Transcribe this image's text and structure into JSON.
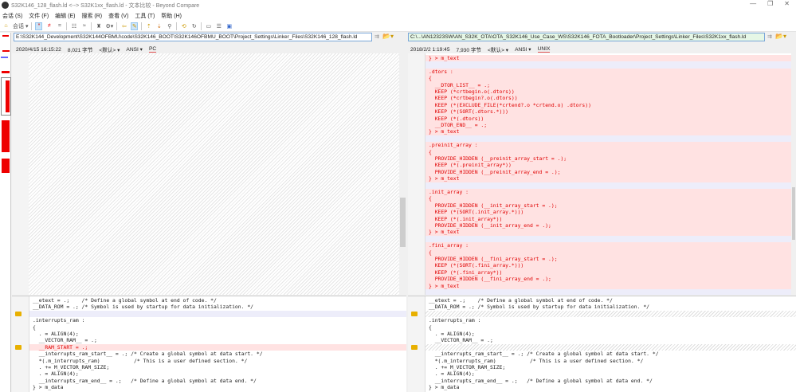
{
  "title": "S32K146_128_flash.ld <--> S32K1xx_flash.ld - 文本比较 - Beyond Compare",
  "menu": [
    "会话 (S)",
    "文件 (F)",
    "编辑 (E)",
    "搜索 (R)",
    "查看 (V)",
    "工具 (T)",
    "帮助 (H)"
  ],
  "toolbar": {
    "session_label": "会话"
  },
  "left": {
    "path": "E:\\S32K144_Development\\S32K144OFBMU\\code\\S32K146_BOOT\\S32K146OFBMU_BOOT\\Project_Settings\\Linker_Files\\S32K146_128_flash.ld",
    "date": "2020/4/15 16:15:22",
    "size": "8,021 字节",
    "format": "<默认>",
    "encoding": "ANSI",
    "eol": "PC"
  },
  "right": {
    "path": "C:\\...\\AN12323SW\\AN_S32K_OTA\\OTA_S32K146_Use_Case_WS\\S32K146_FOTA_Bootloader\\Project_Settings\\Linker_Files\\S32K1xx_flash.ld",
    "date": "2018/2/2 1:19:45",
    "size": "7,930 字节",
    "format": "<默认>",
    "encoding": "ANSI",
    "eol": "UNIX"
  },
  "right_top_lines": [
    {
      "t": "} > m_text",
      "k": "diff"
    },
    {
      "t": "",
      "k": "gap"
    },
    {
      "t": ".dtors :",
      "k": "diff"
    },
    {
      "t": "{",
      "k": "diff"
    },
    {
      "t": "  __DTOR_LIST__ = .;",
      "k": "diff"
    },
    {
      "t": "  KEEP (*crtbegin.o(.dtors))",
      "k": "diff"
    },
    {
      "t": "  KEEP (*crtbegin?.o(.dtors))",
      "k": "diff"
    },
    {
      "t": "  KEEP (*(EXCLUDE_FILE(*crtend?.o *crtend.o) .dtors))",
      "k": "diff"
    },
    {
      "t": "  KEEP (*(SORT(.dtors.*)))",
      "k": "diff"
    },
    {
      "t": "  KEEP (*(.dtors))",
      "k": "diff"
    },
    {
      "t": "  __DTOR_END__ = .;",
      "k": "diff"
    },
    {
      "t": "} > m_text",
      "k": "diff"
    },
    {
      "t": "",
      "k": "gap"
    },
    {
      "t": ".preinit_array :",
      "k": "diff"
    },
    {
      "t": "{",
      "k": "diff"
    },
    {
      "t": "  PROVIDE_HIDDEN (__preinit_array_start = .);",
      "k": "diff"
    },
    {
      "t": "  KEEP (*(.preinit_array*))",
      "k": "diff"
    },
    {
      "t": "  PROVIDE_HIDDEN (__preinit_array_end = .);",
      "k": "diff"
    },
    {
      "t": "} > m_text",
      "k": "diff"
    },
    {
      "t": "",
      "k": "gap"
    },
    {
      "t": ".init_array :",
      "k": "diff"
    },
    {
      "t": "{",
      "k": "diff"
    },
    {
      "t": "  PROVIDE_HIDDEN (__init_array_start = .);",
      "k": "diff"
    },
    {
      "t": "  KEEP (*(SORT(.init_array.*)))",
      "k": "diff"
    },
    {
      "t": "  KEEP (*(.init_array*))",
      "k": "diff"
    },
    {
      "t": "  PROVIDE_HIDDEN (__init_array_end = .);",
      "k": "diff"
    },
    {
      "t": "} > m_text",
      "k": "diff"
    },
    {
      "t": "",
      "k": "gap"
    },
    {
      "t": ".fini_array :",
      "k": "diff"
    },
    {
      "t": "{",
      "k": "diff"
    },
    {
      "t": "  PROVIDE_HIDDEN (__fini_array_start = .);",
      "k": "diff"
    },
    {
      "t": "  KEEP (*(SORT(.fini_array.*)))",
      "k": "diff"
    },
    {
      "t": "  KEEP (*(.fini_array*))",
      "k": "diff"
    },
    {
      "t": "  PROVIDE_HIDDEN (__fini_array_end = .);",
      "k": "diff"
    },
    {
      "t": "} > m_text",
      "k": "diff"
    },
    {
      "t": "",
      "k": "gap"
    }
  ],
  "left_bottom_lines": [
    {
      "t": "__etext = .;    /* Define a global symbol at end of code. */",
      "k": ""
    },
    {
      "t": "__DATA_ROM = .; /* Symbol is used by startup for data initialization. */",
      "k": ""
    },
    {
      "t": "",
      "k": "gap",
      "a": 1
    },
    {
      "t": ".interrupts_ram :",
      "k": ""
    },
    {
      "t": "{",
      "k": ""
    },
    {
      "t": "  . = ALIGN(4);",
      "k": ""
    },
    {
      "t": "  __VECTOR_RAM__ = .;",
      "k": ""
    },
    {
      "t": "  __RAM_START = .;",
      "k": "diff",
      "a": 1
    },
    {
      "t": "  __interrupts_ram_start__ = .; /* Create a global symbol at data start. */",
      "k": ""
    },
    {
      "t": "  *(.m_interrupts_ram)           /* This is a user defined section. */",
      "k": ""
    },
    {
      "t": "  . += M_VECTOR_RAM_SIZE;",
      "k": ""
    },
    {
      "t": "  . = ALIGN(4);",
      "k": ""
    },
    {
      "t": "  __interrupts_ram_end__ = .;   /* Define a global symbol at data end. */",
      "k": ""
    },
    {
      "t": "} > m_data",
      "k": ""
    }
  ],
  "right_bottom_lines": [
    {
      "t": "__etext = .;    /* Define a global symbol at end of code. */",
      "k": ""
    },
    {
      "t": "__DATA_ROM = .; /* Symbol is used by startup for data initialization. */",
      "k": ""
    },
    {
      "t": "",
      "k": "hat",
      "a": 1
    },
    {
      "t": ".interrupts_ram :",
      "k": ""
    },
    {
      "t": "{",
      "k": ""
    },
    {
      "t": "  . = ALIGN(4);",
      "k": ""
    },
    {
      "t": "  __VECTOR_RAM__ = .;",
      "k": ""
    },
    {
      "t": "",
      "k": "hat",
      "a": 1
    },
    {
      "t": "  __interrupts_ram_start__ = .; /* Create a global symbol at data start. */",
      "k": ""
    },
    {
      "t": "  *(.m_interrupts_ram)           /* This is a user defined section. */",
      "k": ""
    },
    {
      "t": "  . += M_VECTOR_RAM_SIZE;",
      "k": ""
    },
    {
      "t": "  . = ALIGN(4);",
      "k": ""
    },
    {
      "t": "  __interrupts_ram_end__ = .;   /* Define a global symbol at data end. */",
      "k": ""
    },
    {
      "t": "} > m_data",
      "k": ""
    }
  ],
  "colors": {
    "diff_bg": "#ffe2e2",
    "diff_text": "#e00000",
    "gap": "#ededfa",
    "right_path_bg": "#e6f7e6"
  }
}
